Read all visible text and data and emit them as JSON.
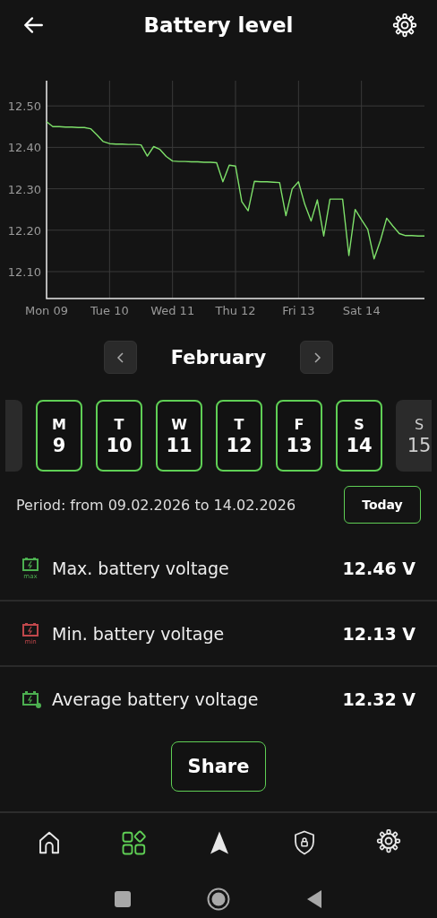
{
  "header": {
    "title": "Battery level"
  },
  "chart": {
    "chart_data": {
      "type": "line",
      "grid": true,
      "ylim": [
        12.035,
        12.561
      ],
      "yticks": [
        {
          "value": 12.1,
          "label": "12.10"
        },
        {
          "value": 12.2,
          "label": "12.20"
        },
        {
          "value": 12.3,
          "label": "12.30"
        },
        {
          "value": 12.4,
          "label": "12.40"
        },
        {
          "value": 12.5,
          "label": "12.50"
        }
      ],
      "categories": [
        "Mon 09",
        null,
        null,
        null,
        null,
        null,
        null,
        null,
        null,
        null,
        "Tue 10",
        null,
        null,
        null,
        null,
        null,
        null,
        null,
        null,
        null,
        "Wed 11",
        null,
        null,
        null,
        null,
        null,
        null,
        null,
        null,
        null,
        "Thu 12",
        null,
        null,
        null,
        null,
        null,
        null,
        null,
        null,
        null,
        "Fri 13",
        null,
        null,
        null,
        null,
        null,
        null,
        null,
        null,
        null,
        "Sat 14",
        null,
        null,
        null,
        null,
        null,
        null,
        null,
        null,
        null,
        null
      ],
      "series": [
        {
          "color": "#7ee06a",
          "values": [
            12.462,
            12.45,
            12.45,
            12.449,
            12.449,
            12.448,
            12.448,
            12.445,
            12.43,
            12.414,
            12.409,
            12.408,
            12.408,
            12.407,
            12.407,
            12.406,
            12.379,
            12.402,
            12.395,
            12.378,
            12.367,
            12.366,
            12.366,
            12.365,
            12.365,
            12.364,
            12.364,
            12.363,
            12.317,
            12.357,
            12.355,
            12.269,
            12.247,
            12.318,
            12.317,
            12.317,
            12.316,
            12.315,
            12.235,
            12.3,
            12.317,
            12.262,
            12.222,
            12.273,
            12.186,
            12.275,
            12.275,
            12.275,
            12.139,
            12.25,
            12.225,
            12.202,
            12.131,
            12.175,
            12.229,
            12.21,
            12.192,
            12.187,
            12.187,
            12.186,
            12.186
          ]
        }
      ]
    }
  },
  "month": "February",
  "days": [
    {
      "selected": false
    },
    {
      "weekday": "M",
      "day": "9",
      "selected": true
    },
    {
      "weekday": "T",
      "day": "10",
      "selected": true
    },
    {
      "weekday": "W",
      "day": "11",
      "selected": true
    },
    {
      "weekday": "T",
      "day": "12",
      "selected": true
    },
    {
      "weekday": "F",
      "day": "13",
      "selected": true
    },
    {
      "weekday": "S",
      "day": "14",
      "selected": true
    },
    {
      "weekday": "S",
      "day": "15",
      "selected": false
    }
  ],
  "period": "Period: from 09.02.2026 to 14.02.2026",
  "today_button": "Today",
  "stats": [
    {
      "kind": "max",
      "icon_label": "max",
      "color": "#4caf50",
      "label": "Max. battery voltage",
      "value": "12.46 V"
    },
    {
      "kind": "min",
      "icon_label": "min",
      "color": "#c0474b",
      "label": "Min. battery voltage",
      "value": "12.13 V"
    },
    {
      "kind": "average",
      "color": "#4caf50",
      "label": "Average battery voltage",
      "value": "12.32 V"
    }
  ],
  "share_button": "Share",
  "nav": [
    {
      "kind": "home",
      "selected": false
    },
    {
      "kind": "apps",
      "selected": true
    },
    {
      "kind": "navigate",
      "selected": false
    },
    {
      "kind": "security",
      "selected": false
    },
    {
      "kind": "settings",
      "selected": false
    }
  ]
}
